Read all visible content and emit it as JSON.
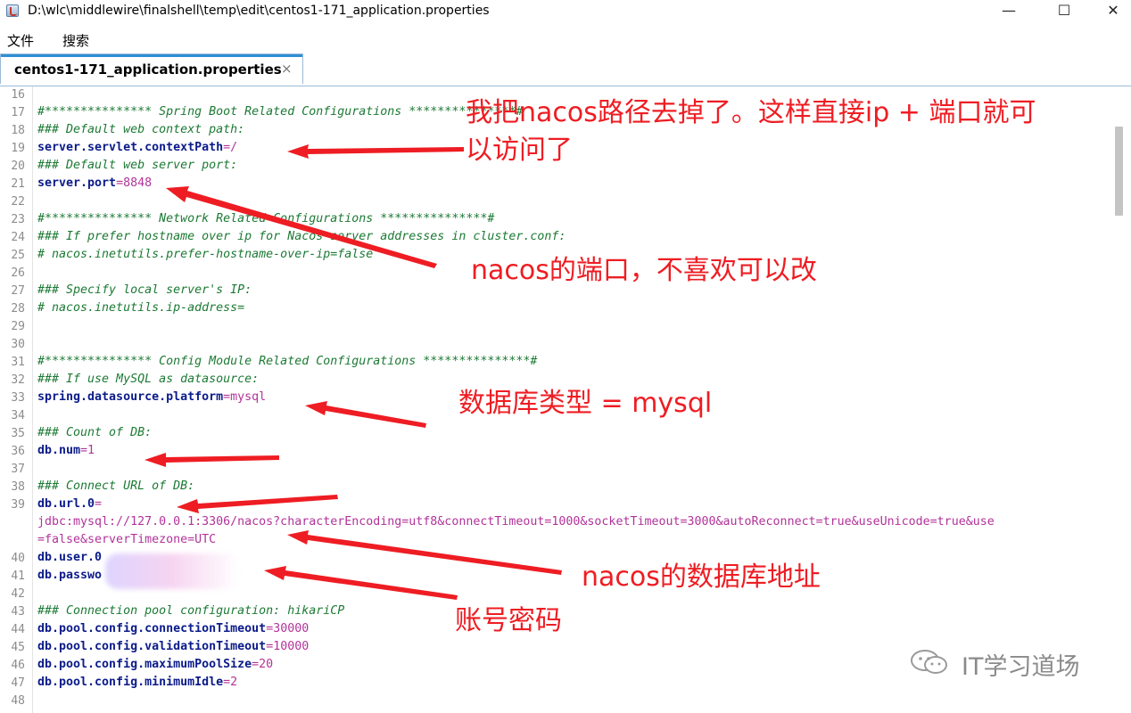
{
  "window": {
    "title": "D:\\wlc\\middlewire\\finalshell\\temp\\edit\\centos1-171_application.properties",
    "minimize": "—",
    "maximize": "☐",
    "close": "✕"
  },
  "menu": {
    "file": "文件",
    "search": "搜索"
  },
  "tab": {
    "label": "centos1-171_application.properties",
    "close": "×"
  },
  "colors": {
    "comment": "#1c7a34",
    "key": "#0b1b8a",
    "value": "#b2339a",
    "annotation": "#ee1d23",
    "tab_accent": "#2e8fd6"
  },
  "editor": {
    "lines": [
      {
        "n": "16",
        "parts": []
      },
      {
        "n": "17",
        "parts": [
          {
            "t": "c",
            "s": "#*************** Spring Boot Related Configurations ***************#"
          }
        ]
      },
      {
        "n": "18",
        "parts": [
          {
            "t": "c",
            "s": "### Default web context path:"
          }
        ]
      },
      {
        "n": "19",
        "parts": [
          {
            "t": "k",
            "s": "server.servlet.contextPath"
          },
          {
            "t": "v",
            "s": "=/"
          }
        ]
      },
      {
        "n": "20",
        "parts": [
          {
            "t": "c",
            "s": "### Default web server port:"
          }
        ]
      },
      {
        "n": "21",
        "parts": [
          {
            "t": "k",
            "s": "server.port"
          },
          {
            "t": "v",
            "s": "=8848"
          }
        ]
      },
      {
        "n": "22",
        "parts": []
      },
      {
        "n": "23",
        "parts": [
          {
            "t": "c",
            "s": "#*************** Network Related Configurations ***************#"
          }
        ]
      },
      {
        "n": "24",
        "parts": [
          {
            "t": "c",
            "s": "### If prefer hostname over ip for Nacos server addresses in cluster.conf:"
          }
        ]
      },
      {
        "n": "25",
        "parts": [
          {
            "t": "c",
            "s": "# nacos.inetutils.prefer-hostname-over-ip=false"
          }
        ]
      },
      {
        "n": "26",
        "parts": []
      },
      {
        "n": "27",
        "parts": [
          {
            "t": "c",
            "s": "### Specify local server's IP:"
          }
        ]
      },
      {
        "n": "28",
        "parts": [
          {
            "t": "c",
            "s": "# nacos.inetutils.ip-address="
          }
        ]
      },
      {
        "n": "29",
        "parts": []
      },
      {
        "n": "30",
        "parts": []
      },
      {
        "n": "31",
        "parts": [
          {
            "t": "c",
            "s": "#*************** Config Module Related Configurations ***************#"
          }
        ]
      },
      {
        "n": "32",
        "parts": [
          {
            "t": "c",
            "s": "### If use MySQL as datasource:"
          }
        ]
      },
      {
        "n": "33",
        "parts": [
          {
            "t": "k",
            "s": "spring.datasource.platform"
          },
          {
            "t": "v",
            "s": "=mysql"
          }
        ]
      },
      {
        "n": "34",
        "parts": []
      },
      {
        "n": "35",
        "parts": [
          {
            "t": "c",
            "s": "### Count of DB:"
          }
        ]
      },
      {
        "n": "36",
        "parts": [
          {
            "t": "k",
            "s": "db.num"
          },
          {
            "t": "v",
            "s": "=1"
          }
        ]
      },
      {
        "n": "37",
        "parts": []
      },
      {
        "n": "38",
        "parts": [
          {
            "t": "c",
            "s": "### Connect URL of DB:"
          }
        ]
      },
      {
        "n": "39",
        "parts": [
          {
            "t": "k",
            "s": "db.url.0"
          },
          {
            "t": "v",
            "s": "="
          }
        ]
      },
      {
        "n": "",
        "parts": [
          {
            "t": "v",
            "s": "jdbc:mysql://127.0.0.1:3306/nacos?characterEncoding=utf8&connectTimeout=1000&socketTimeout=3000&autoReconnect=true&useUnicode=true&use"
          }
        ]
      },
      {
        "n": "",
        "parts": [
          {
            "t": "v",
            "s": "=false&serverTimezone=UTC"
          }
        ]
      },
      {
        "n": "40",
        "parts": [
          {
            "t": "k",
            "s": "db.user.0"
          }
        ]
      },
      {
        "n": "41",
        "parts": [
          {
            "t": "k",
            "s": "db.passwo"
          }
        ]
      },
      {
        "n": "42",
        "parts": []
      },
      {
        "n": "43",
        "parts": [
          {
            "t": "c",
            "s": "### Connection pool configuration: hikariCP"
          }
        ]
      },
      {
        "n": "44",
        "parts": [
          {
            "t": "k",
            "s": "db.pool.config.connectionTimeout"
          },
          {
            "t": "v",
            "s": "=30000"
          }
        ]
      },
      {
        "n": "45",
        "parts": [
          {
            "t": "k",
            "s": "db.pool.config.validationTimeout"
          },
          {
            "t": "v",
            "s": "=10000"
          }
        ]
      },
      {
        "n": "46",
        "parts": [
          {
            "t": "k",
            "s": "db.pool.config.maximumPoolSize"
          },
          {
            "t": "v",
            "s": "=20"
          }
        ]
      },
      {
        "n": "47",
        "parts": [
          {
            "t": "k",
            "s": "db.pool.config.minimumIdle"
          },
          {
            "t": "v",
            "s": "=2"
          }
        ]
      },
      {
        "n": "48",
        "parts": []
      }
    ]
  },
  "annotations": {
    "context_path_line1": "我把nacos路径去掉了。这样直接ip + 端口就可",
    "context_path_line2": "以访问了",
    "port": "nacos的端口，不喜欢可以改",
    "db_type": "数据库类型 = mysql",
    "db_url": "nacos的数据库地址",
    "account": "账号密码"
  },
  "watermark": {
    "text": "IT学习道场",
    "icon": "wechat-icon"
  }
}
